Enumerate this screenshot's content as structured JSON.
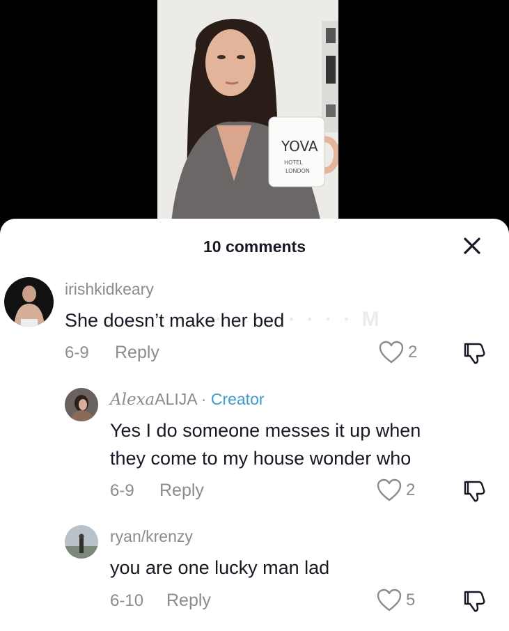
{
  "video": {
    "mug_brand": "YOVA",
    "mug_line1": "HOTEL",
    "mug_line2": "LONDON"
  },
  "sheet": {
    "title": "10 comments",
    "close_icon": "close-icon"
  },
  "comments": [
    {
      "username": "irishkidkeary",
      "text": "She doesn’t make her bed",
      "date": "6-9",
      "reply_label": "Reply",
      "likes": "2"
    },
    {
      "username_script": "Alexa",
      "username_rest": "ALIJA",
      "separator": "·",
      "creator_badge": "Creator",
      "text_line1": "Yes I do someone messes it up when",
      "text_line2": "they come to my house wonder who",
      "date": "6-9",
      "reply_label": "Reply",
      "likes": "2"
    },
    {
      "username": "ryan/krenzy",
      "text": "you are one lucky man lad",
      "date": "6-10",
      "reply_label": "Reply",
      "likes": "5"
    }
  ],
  "colors": {
    "text_primary": "#161823",
    "text_secondary": "#8a8b91",
    "creator_accent": "#3d9bd1"
  }
}
